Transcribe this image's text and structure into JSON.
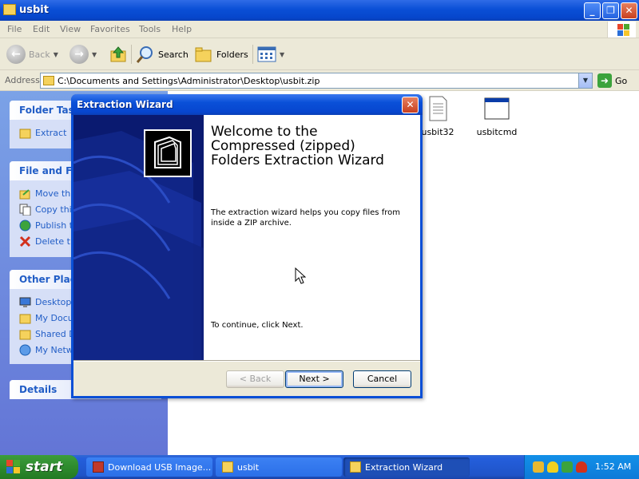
{
  "window": {
    "title": "usbit"
  },
  "menu": [
    "File",
    "Edit",
    "View",
    "Favorites",
    "Tools",
    "Help"
  ],
  "toolbar": {
    "back_label": "Back",
    "search_label": "Search",
    "folders_label": "Folders"
  },
  "address": {
    "label": "Address",
    "value": "C:\\Documents and Settings\\Administrator\\Desktop\\usbit.zip",
    "go_label": "Go"
  },
  "sidebar": {
    "folder_tasks": {
      "title": "Folder Task",
      "items": [
        "Extract"
      ]
    },
    "file_folder": {
      "title": "File and Fol",
      "items": [
        "Move th",
        "Copy thi",
        "Publish t",
        "Delete t"
      ]
    },
    "other_places": {
      "title": "Other Place",
      "items": [
        "Desktop",
        "My Docu",
        "Shared D",
        "My Netw"
      ]
    },
    "details": {
      "title": "Details"
    }
  },
  "files": [
    {
      "name": "usbit32"
    },
    {
      "name": "usbitcmd"
    }
  ],
  "dialog": {
    "title": "Extraction Wizard",
    "heading": "Welcome to the Compressed (zipped) Folders Extraction Wizard",
    "description": "The extraction wizard helps you copy files from inside a ZIP archive.",
    "continue_text": "To continue, click Next.",
    "back_label": "< Back",
    "next_label": "Next >",
    "cancel_label": "Cancel"
  },
  "taskbar": {
    "start_label": "start",
    "items": [
      "Download USB Image...",
      "usbit",
      "Extraction Wizard"
    ],
    "clock": "1:52 AM"
  },
  "colors": {
    "xp_blue": "#0a4fd6",
    "link_blue": "#215dc6",
    "wizard_side": "#0a1a70"
  }
}
